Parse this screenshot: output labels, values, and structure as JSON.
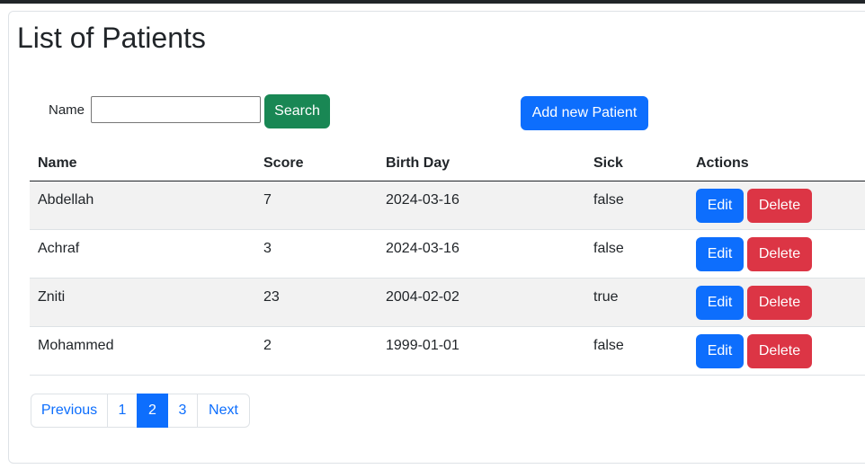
{
  "page": {
    "title": "List of Patients"
  },
  "search": {
    "label": "Name",
    "value": "",
    "placeholder": "",
    "button_label": "Search"
  },
  "add_button_label": "Add new Patient",
  "table": {
    "headers": [
      "Name",
      "Score",
      "Birth Day",
      "Sick",
      "Actions"
    ],
    "rows": [
      {
        "name": "Abdellah",
        "score": "7",
        "birth_day": "2024-03-16",
        "sick": "false"
      },
      {
        "name": "Achraf",
        "score": "3",
        "birth_day": "2024-03-16",
        "sick": "false"
      },
      {
        "name": "Zniti",
        "score": "23",
        "birth_day": "2004-02-02",
        "sick": "true"
      },
      {
        "name": "Mohammed",
        "score": "2",
        "birth_day": "1999-01-01",
        "sick": "false"
      }
    ],
    "edit_label": "Edit",
    "delete_label": "Delete"
  },
  "pagination": {
    "previous": "Previous",
    "pages": [
      "1",
      "2",
      "3"
    ],
    "active_page": "2",
    "next": "Next"
  },
  "colors": {
    "primary": "#0d6efd",
    "success": "#198754",
    "danger": "#dc3545",
    "stripe": "#f2f2f2"
  }
}
